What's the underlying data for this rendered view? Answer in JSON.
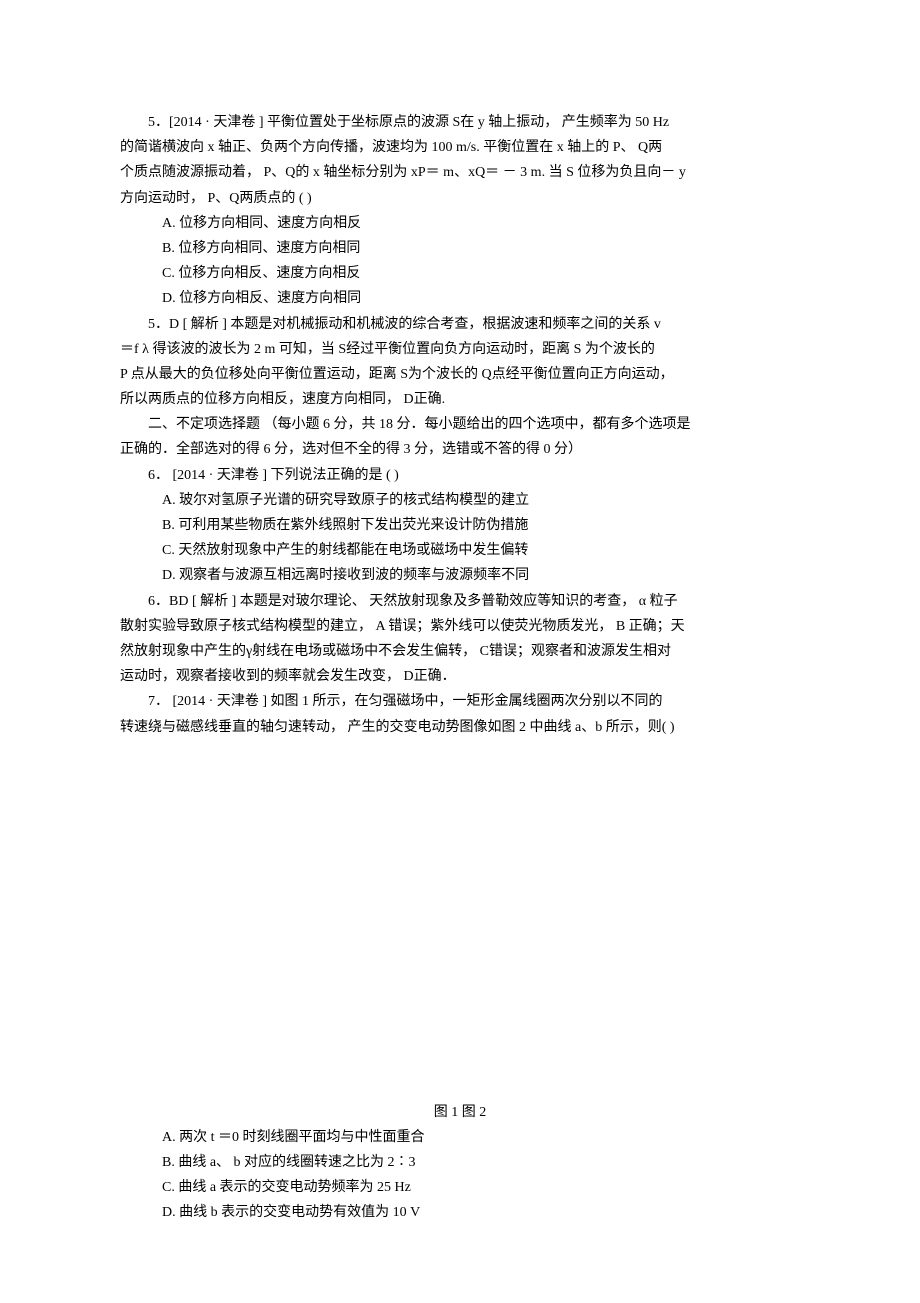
{
  "q5": {
    "stem_l1": "5．[2014 · 天津卷 ]  平衡位置处于坐标原点的波源     S在 y 轴上振动， 产生频率为  50 Hz",
    "stem_l2": "的简谐横波向   x 轴正、负两个方向传播，波速均为      100 m/s. 平衡位置在  x 轴上的  P、 Q两",
    "stem_l3": "个质点随波源振动着，    P、Q的 x 轴坐标分别为   xP＝ m、xQ＝ － 3 m.  当  S 位移为负且向－  y",
    "stem_l4": "方向运动时，  P、Q两质点的 (       )",
    "opt_a": "A.  位移方向相同、速度方向相反",
    "opt_b": "B.  位移方向相同、速度方向相同",
    "opt_c": "C.  位移方向相反、速度方向相反",
    "opt_d": "D.  位移方向相反、速度方向相同",
    "ans_l1": "5．D   [ 解析 ]   本题是对机械振动和机械波的综合考查，根据波速和频率之间的关系            v",
    "ans_l2": "＝f λ  得该波的波长为   2 m  可知，当   S经过平衡位置向负方向运动时，距离     S 为个波长的",
    "ans_l3": "P 点从最大的负位移处向平衡位置运动，距离       S为个波长的  Q点经平衡位置向正方向运动，",
    "ans_l4": "所以两质点的位移方向相反，速度方向相同，       D正确."
  },
  "section2": {
    "l1": "二、不定项选择题  （每小题  6 分，共  18 分．每小题给出的四个选项中，都有多个选项是",
    "l2": "正确的．全部选对的得    6 分，选对但不全的得    3 分，选错或不答的得    0 分）"
  },
  "q6": {
    "stem": "6．  [2014 · 天津卷 ]  下列说法正确的是  (        )",
    "opt_a": "A.  玻尔对氢原子光谱的研究导致原子的核式结构模型的建立",
    "opt_b": "B.  可利用某些物质在紫外线照射下发出荧光来设计防伪措施",
    "opt_c": "C.  天然放射现象中产生的射线都能在电场或磁场中发生偏转",
    "opt_d": "D.  观察者与波源互相远离时接收到波的频率与波源频率不同",
    "ans_l1": "6．BD   [ 解析 ]   本题是对玻尔理论、   天然放射现象及多普勒效应等知识的考查，       α 粒子",
    "ans_l2": "散射实验导致原子核式结构模型的建立，       A 错误；紫外线可以使荧光物质发光，       B 正确；天",
    "ans_l3": "然放射现象中产生的γ射线在电场或磁场中不会发生偏转，          C错误；观察者和波源发生相对",
    "ans_l4": "运动时，观察者接收到的频率就会发生改变，       D正确．"
  },
  "q7": {
    "stem_l1": "7．  [2014 · 天津卷 ]   如图 1 所示，在匀强磁场中，一矩形金属线圈两次分别以不同的",
    "stem_l2": "转速绕与磁感线垂直的轴匀速转动，   产生的交变电动势图像如图    2 中曲线  a、b 所示，则(       )",
    "fig_line": "图 1                            图 2",
    "opt_a": "A.  两次  t ＝0 时刻线圈平面均与中性面重合",
    "opt_b": "B.  曲线  a、 b 对应的线圈转速之比为    2∶3",
    "opt_c": "C.  曲线  a 表示的交变电动势频率为    25 Hz",
    "opt_d": "D.  曲线  b 表示的交变电动势有效值为    10 V"
  }
}
